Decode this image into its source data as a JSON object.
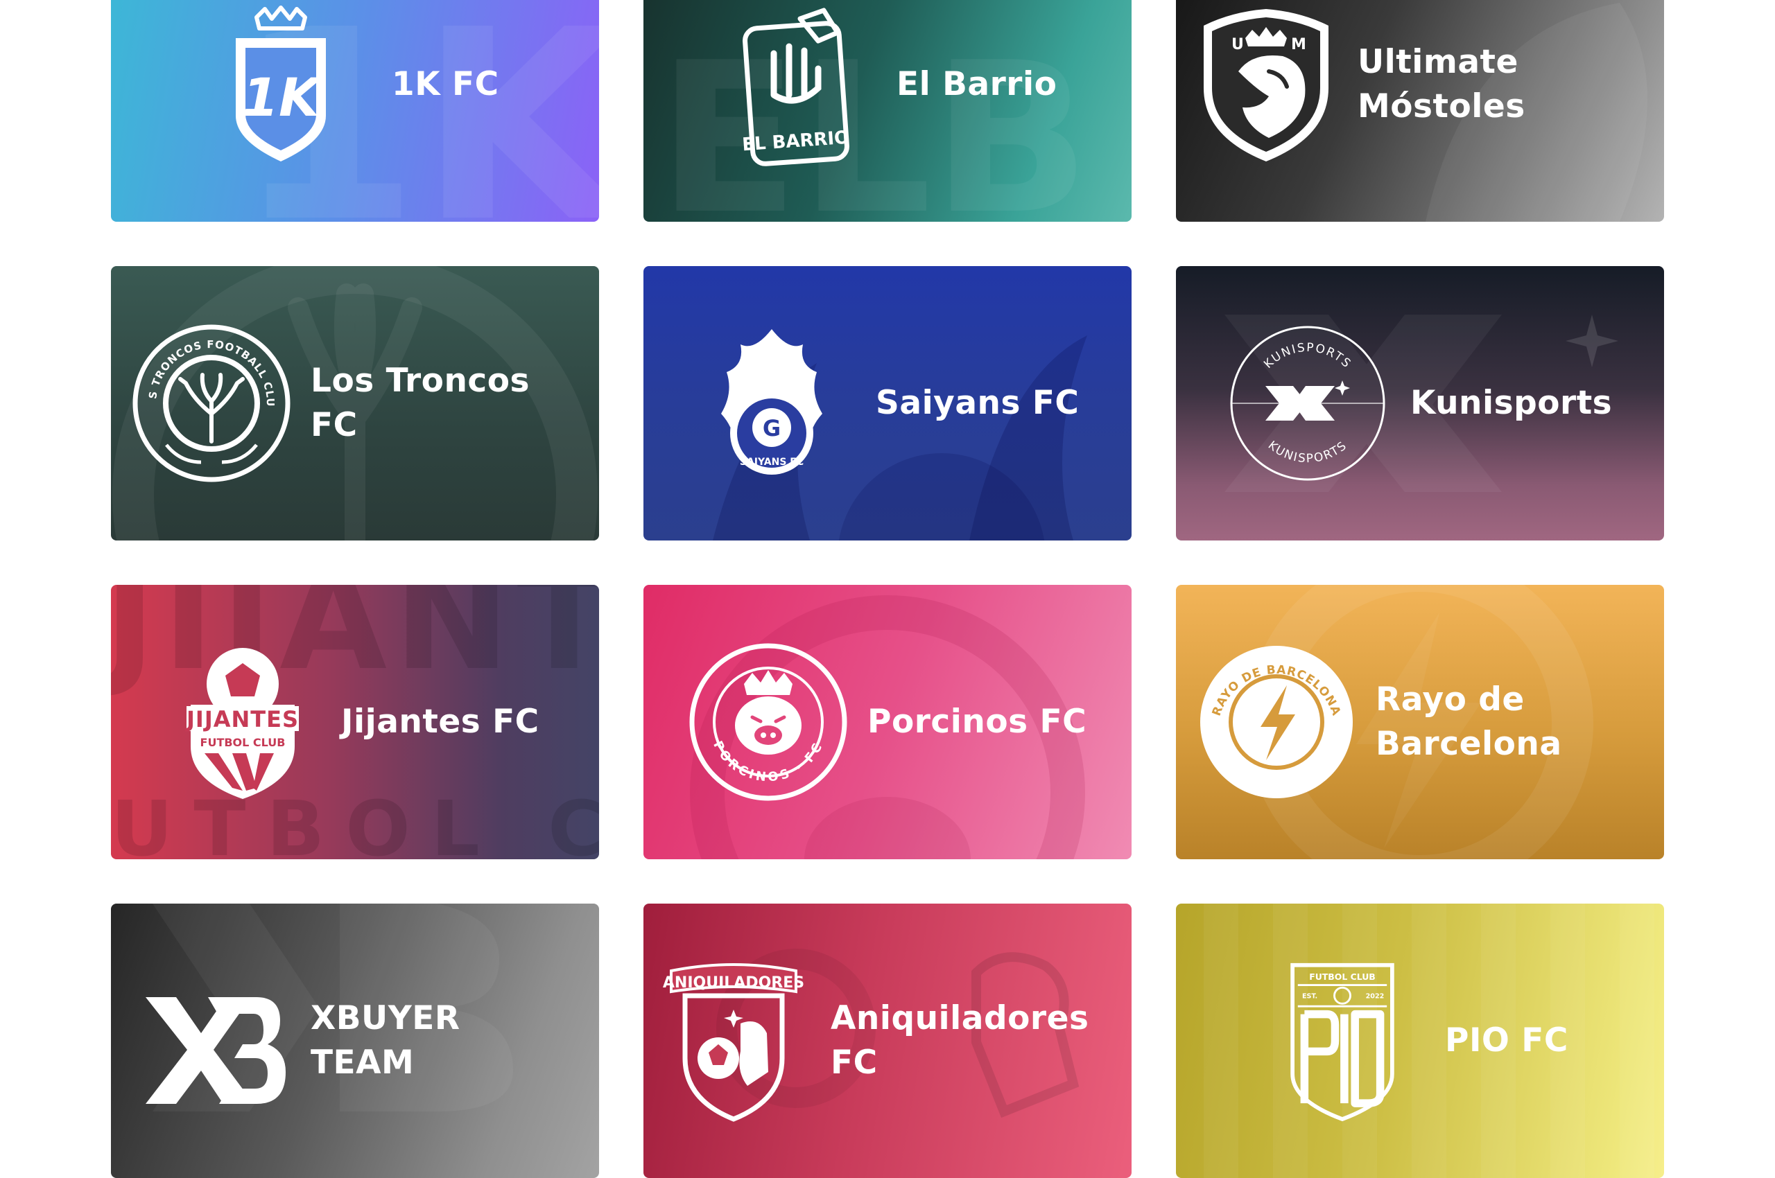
{
  "teams": [
    {
      "name": "1K FC",
      "logo_icon": "1k-fc-shield-crown-icon"
    },
    {
      "name": "El Barrio",
      "logo_icon": "el-barrio-hand-sign-icon"
    },
    {
      "name": "Ultimate\nMóstoles",
      "logo_icon": "ultimate-mostoles-lion-shield-icon",
      "logo_text": "U M"
    },
    {
      "name": "Los Troncos\nFC",
      "logo_icon": "los-troncos-tree-badge-icon",
      "logo_text": "LOS TRONCOS FOOTBALL CLUB"
    },
    {
      "name": "Saiyans FC",
      "logo_icon": "saiyans-flame-ball-icon",
      "logo_text": "SAIYANS FC"
    },
    {
      "name": "Kunisports",
      "logo_icon": "kunisports-k-circle-icon",
      "logo_text": "KUNISPORTS"
    },
    {
      "name": "Jijantes FC",
      "logo_icon": "jijantes-ball-shield-icon",
      "logo_text": "JIJANTES FUTBOL CLUB"
    },
    {
      "name": "Porcinos FC",
      "logo_icon": "porcinos-pig-crown-icon",
      "logo_text": "PORCINOS · FC"
    },
    {
      "name": "Rayo de\nBarcelona",
      "logo_icon": "rayo-lightning-ball-icon",
      "logo_text": "RAYO DE BARCELONA"
    },
    {
      "name": "XBUYER\nTEAM",
      "logo_icon": "xbuyer-xb-monogram-icon"
    },
    {
      "name": "Aniquiladores\nFC",
      "logo_icon": "aniquiladores-fist-shield-icon",
      "logo_text": "ANIQUILADORES"
    },
    {
      "name": "PIO FC",
      "logo_icon": "pio-fc-shield-icon",
      "logo_text": "FUTBOL CLUB EST. 2022"
    }
  ],
  "colors": {
    "text": "#ffffff",
    "page_background": "#ffffff"
  }
}
